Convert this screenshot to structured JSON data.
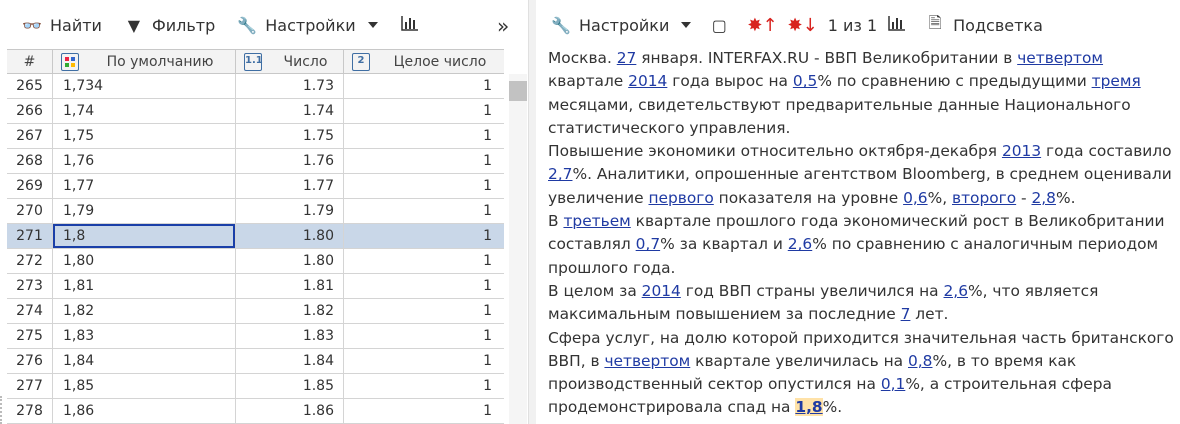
{
  "left_toolbar": {
    "find_label": "Найти",
    "filter_label": "Фильтр",
    "settings_label": "Настройки",
    "more_glyph": "»"
  },
  "grid": {
    "columns": [
      {
        "label": "#",
        "icon": ""
      },
      {
        "label": "По умолчанию",
        "icon": "grid-color-icon"
      },
      {
        "label": "Число",
        "icon": "1.1"
      },
      {
        "label": "Целое число",
        "icon": "2"
      }
    ],
    "rows": [
      {
        "n": "265",
        "def": "1,734",
        "num": "1.73",
        "int": "1"
      },
      {
        "n": "266",
        "def": "1,74",
        "num": "1.74",
        "int": "1"
      },
      {
        "n": "267",
        "def": "1,75",
        "num": "1.75",
        "int": "1"
      },
      {
        "n": "268",
        "def": "1,76",
        "num": "1.76",
        "int": "1"
      },
      {
        "n": "269",
        "def": "1,77",
        "num": "1.77",
        "int": "1"
      },
      {
        "n": "270",
        "def": "1,79",
        "num": "1.79",
        "int": "1"
      },
      {
        "n": "271",
        "def": "1,8",
        "num": "1.80",
        "int": "1"
      },
      {
        "n": "272",
        "def": "1,80",
        "num": "1.80",
        "int": "1"
      },
      {
        "n": "273",
        "def": "1,81",
        "num": "1.81",
        "int": "1"
      },
      {
        "n": "274",
        "def": "1,82",
        "num": "1.82",
        "int": "1"
      },
      {
        "n": "275",
        "def": "1,83",
        "num": "1.83",
        "int": "1"
      },
      {
        "n": "276",
        "def": "1,84",
        "num": "1.84",
        "int": "1"
      },
      {
        "n": "277",
        "def": "1,85",
        "num": "1.85",
        "int": "1"
      },
      {
        "n": "278",
        "def": "1,86",
        "num": "1.86",
        "int": "1"
      }
    ],
    "selected_row": "271"
  },
  "right_toolbar": {
    "settings_label": "Настройки",
    "counter": "1 из 1",
    "highlight_label": "Подсветка"
  },
  "colors": {
    "selection": "#c9d7e8",
    "edit_border": "#1a3fa8",
    "link": "#1f3aa3",
    "highlight": "#ffe2a8"
  },
  "document": {
    "paragraphs": [
      [
        {
          "t": "Москва. "
        },
        {
          "t": "27",
          "link": true
        },
        {
          "t": " января. INTERFAX.RU - ВВП Великобритании в "
        },
        {
          "t": "четвертом",
          "link": true
        },
        {
          "t": " квартале "
        },
        {
          "t": "2014",
          "link": true
        },
        {
          "t": " года вырос на "
        },
        {
          "t": "0,5",
          "link": true
        },
        {
          "t": "% по сравнению с предыдущими "
        },
        {
          "t": "тремя",
          "link": true
        },
        {
          "t": " месяцами, свидетельствуют предварительные данные Национального статистического управления."
        }
      ],
      [
        {
          "t": "Повышение экономики относительно октября-декабря "
        },
        {
          "t": "2013",
          "link": true
        },
        {
          "t": " года составило "
        },
        {
          "t": "2,7",
          "link": true
        },
        {
          "t": "%. Аналитики, опрошенные агентством Bloomberg, в среднем оценивали увеличение "
        },
        {
          "t": "первого",
          "link": true
        },
        {
          "t": " показателя на уровне "
        },
        {
          "t": "0,6",
          "link": true
        },
        {
          "t": "%, "
        },
        {
          "t": "второго",
          "link": true
        },
        {
          "t": " - "
        },
        {
          "t": "2,8",
          "link": true
        },
        {
          "t": "%."
        }
      ],
      [
        {
          "t": "В "
        },
        {
          "t": "третьем",
          "link": true
        },
        {
          "t": " квартале прошлого года экономический рост в Великобритании составлял "
        },
        {
          "t": "0,7",
          "link": true
        },
        {
          "t": "% за квартал и "
        },
        {
          "t": "2,6",
          "link": true
        },
        {
          "t": "% по сравнению с аналогичным периодом прошлого года."
        }
      ],
      [
        {
          "t": "В целом за "
        },
        {
          "t": "2014",
          "link": true
        },
        {
          "t": " год ВВП страны увеличился на "
        },
        {
          "t": "2,6",
          "link": true
        },
        {
          "t": "%, что является максимальным повышением за последние "
        },
        {
          "t": "7",
          "link": true
        },
        {
          "t": " лет."
        }
      ],
      [
        {
          "t": "Сфера услуг, на долю которой приходится значительная часть британского ВВП, в "
        },
        {
          "t": "четвертом",
          "link": true
        },
        {
          "t": " квартале увеличилась на "
        },
        {
          "t": "0,8",
          "link": true
        },
        {
          "t": "%, в то время как производственный сектор опустился на "
        },
        {
          "t": "0,1",
          "link": true
        },
        {
          "t": "%, а строительная сфера продемонстрировала спад на "
        },
        {
          "t": "1,8",
          "link": true,
          "highlight": true
        },
        {
          "t": "%."
        }
      ]
    ]
  }
}
